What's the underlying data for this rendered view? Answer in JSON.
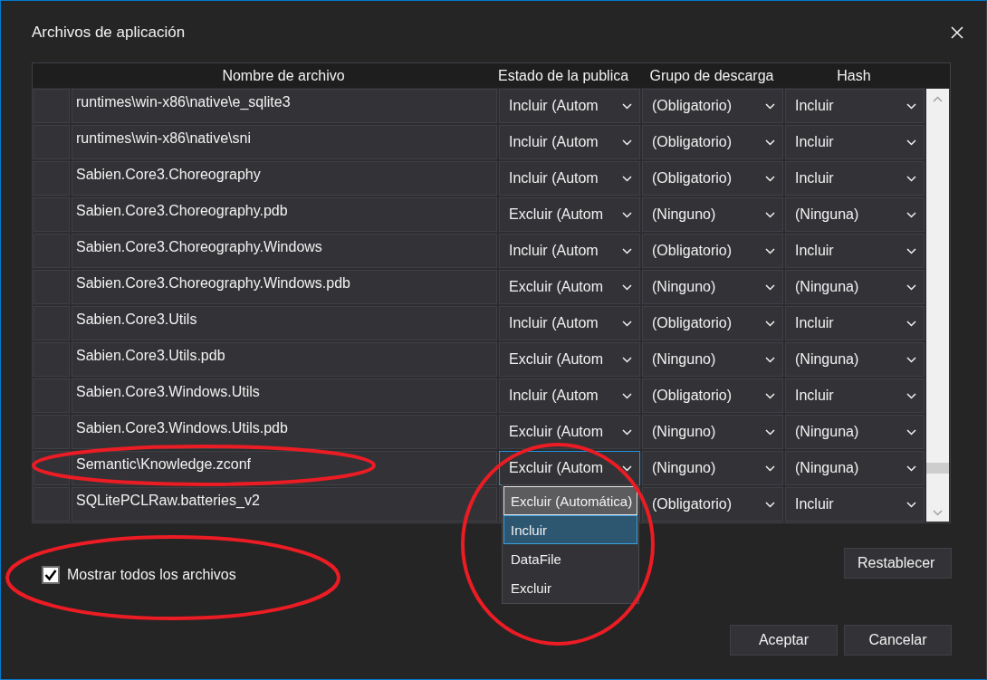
{
  "window": {
    "title": "Archivos de aplicación"
  },
  "table": {
    "columns": [
      "Nombre de archivo",
      "Estado de la publica",
      "Grupo de descarga",
      "Hash"
    ],
    "rows": [
      {
        "name": "runtimes\\win-x86\\native\\e_sqlite3",
        "status": "Incluir (Autom",
        "group": "(Obligatorio)",
        "hash": "Incluir",
        "focused": false,
        "circled": false
      },
      {
        "name": "runtimes\\win-x86\\native\\sni",
        "status": "Incluir (Autom",
        "group": "(Obligatorio)",
        "hash": "Incluir",
        "focused": false,
        "circled": false
      },
      {
        "name": "Sabien.Core3.Choreography",
        "status": "Incluir (Autom",
        "group": "(Obligatorio)",
        "hash": "Incluir",
        "focused": false,
        "circled": false
      },
      {
        "name": "Sabien.Core3.Choreography.pdb",
        "status": "Excluir (Autom",
        "group": "(Ninguno)",
        "hash": "(Ninguna)",
        "focused": false,
        "circled": false
      },
      {
        "name": "Sabien.Core3.Choreography.Windows",
        "status": "Incluir (Autom",
        "group": "(Obligatorio)",
        "hash": "Incluir",
        "focused": false,
        "circled": false
      },
      {
        "name": "Sabien.Core3.Choreography.Windows.pdb",
        "status": "Excluir (Autom",
        "group": "(Ninguno)",
        "hash": "(Ninguna)",
        "focused": false,
        "circled": false
      },
      {
        "name": "Sabien.Core3.Utils",
        "status": "Incluir (Autom",
        "group": "(Obligatorio)",
        "hash": "Incluir",
        "focused": false,
        "circled": false
      },
      {
        "name": "Sabien.Core3.Utils.pdb",
        "status": "Excluir (Autom",
        "group": "(Ninguno)",
        "hash": "(Ninguna)",
        "focused": false,
        "circled": false
      },
      {
        "name": "Sabien.Core3.Windows.Utils",
        "status": "Incluir (Autom",
        "group": "(Obligatorio)",
        "hash": "Incluir",
        "focused": false,
        "circled": false
      },
      {
        "name": "Sabien.Core3.Windows.Utils.pdb",
        "status": "Excluir (Autom",
        "group": "(Ninguno)",
        "hash": "(Ninguna)",
        "focused": false,
        "circled": false
      },
      {
        "name": "Semantic\\Knowledge.zconf",
        "status": "Excluir (Autom",
        "group": "(Ninguno)",
        "hash": "(Ninguna)",
        "focused": true,
        "circled": true
      },
      {
        "name": "SQLitePCLRaw.batteries_v2",
        "group": "(Obligatorio)",
        "hash": "Incluir",
        "focused": false,
        "circled": false
      }
    ]
  },
  "dropdown": {
    "circled": true,
    "options": [
      {
        "label": "Excluir (Automática)",
        "current": true,
        "selected": false
      },
      {
        "label": "Incluir",
        "current": false,
        "selected": true
      },
      {
        "label": "DataFile",
        "current": false,
        "selected": false
      },
      {
        "label": "Excluir",
        "current": false,
        "selected": false
      }
    ]
  },
  "checkbox": {
    "label": "Mostrar todos los archivos",
    "checked": true,
    "circled": true
  },
  "reset_button": {
    "label": "Restablecer"
  },
  "ok_button": {
    "label": "Aceptar"
  },
  "cancel_button": {
    "label": "Cancelar"
  }
}
